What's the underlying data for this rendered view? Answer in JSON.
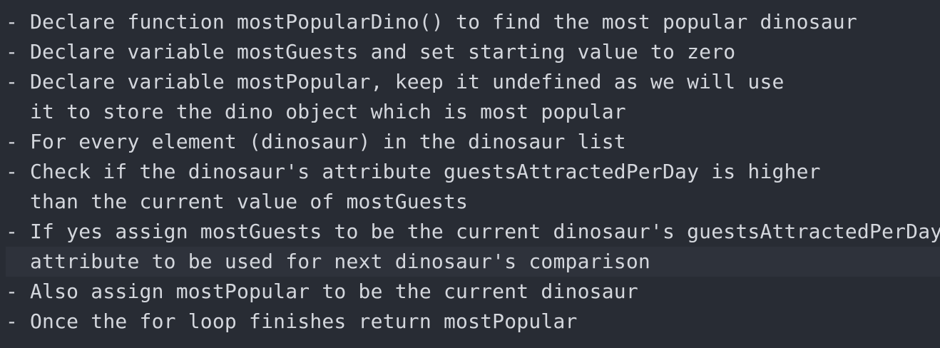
{
  "editor": {
    "bullet": "-",
    "lines": [
      {
        "bullet": true,
        "text": "Declare function mostPopularDino() to find the most popular dinosaur"
      },
      {
        "bullet": true,
        "text": "Declare variable mostGuests and set starting value to zero"
      },
      {
        "bullet": true,
        "text": "Declare variable mostPopular, keep it undefined as we will use"
      },
      {
        "bullet": false,
        "text": "it to store the dino object which is most popular"
      },
      {
        "bullet": true,
        "text": "For every element (dinosaur) in the dinosaur list"
      },
      {
        "bullet": true,
        "text": "Check if the dinosaur's attribute guestsAttractedPerDay is higher"
      },
      {
        "bullet": false,
        "text": "than the current value of mostGuests"
      },
      {
        "bullet": true,
        "text": "If yes assign mostGuests to be the current dinosaur's guestsAttractedPerDay"
      },
      {
        "bullet": false,
        "text": "attribute to be used for next dinosaur's comparison",
        "current": true
      },
      {
        "bullet": true,
        "text": "Also assign mostPopular to be the current dinosaur"
      },
      {
        "bullet": true,
        "text": "Once the for loop finishes return mostPopular"
      }
    ]
  },
  "colors": {
    "background": "#282c34",
    "current_line": "#2e323b",
    "text": "#d4d7dd"
  }
}
